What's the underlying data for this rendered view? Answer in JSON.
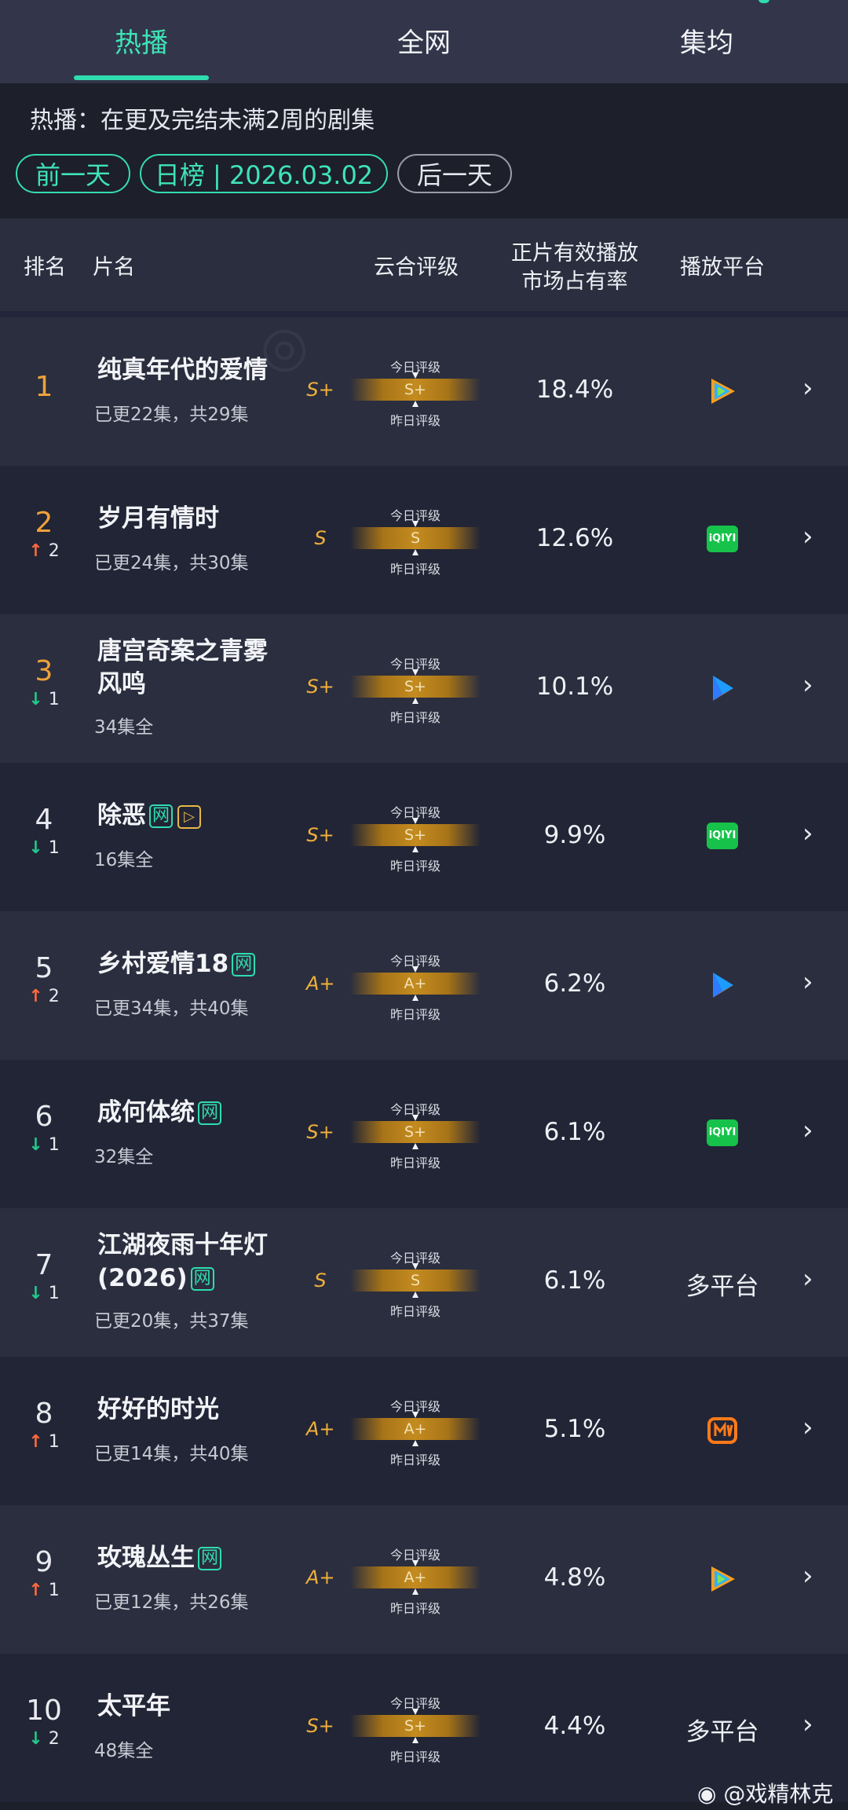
{
  "tabs": [
    {
      "label": "热播",
      "active": true
    },
    {
      "label": "全网",
      "active": false
    },
    {
      "label": "集均",
      "active": false
    }
  ],
  "description": "热播：在更及完结未满2周的剧集",
  "date_nav": {
    "prev": "前一天",
    "current": "日榜 | 2026.03.02",
    "next": "后一天"
  },
  "columns": {
    "rank": "排名",
    "title": "片名",
    "grade": "云合评级",
    "share_line1": "正片有效播放",
    "share_line2": "市场占有率",
    "platform": "播放平台"
  },
  "grade_labels": {
    "today": "今日评级",
    "yesterday": "昨日评级"
  },
  "rows": [
    {
      "rank": "1",
      "change": "",
      "dir": "",
      "title": "纯真年代的爱情",
      "title2": "",
      "badges": [],
      "episodes": "已更22集，共29集",
      "yesterday": "S+",
      "today": "S+",
      "share": "18.4%",
      "platform": "tencent-video-icon",
      "platform_text": ""
    },
    {
      "rank": "2",
      "change": "2",
      "dir": "up",
      "title": "岁月有情时",
      "title2": "",
      "badges": [],
      "episodes": "已更24集，共30集",
      "yesterday": "S",
      "today": "S",
      "share": "12.6%",
      "platform": "iqiyi-icon",
      "platform_text": "iQIYI"
    },
    {
      "rank": "3",
      "change": "1",
      "dir": "down",
      "title": "唐宫奇案之青雾",
      "title2": "风鸣",
      "badges": [],
      "episodes": "34集全",
      "yesterday": "S+",
      "today": "S+",
      "share": "10.1%",
      "platform": "youku-icon",
      "platform_text": ""
    },
    {
      "rank": "4",
      "change": "1",
      "dir": "down",
      "title": "除恶",
      "title2": "",
      "badges": [
        "网",
        "▷"
      ],
      "episodes": "16集全",
      "yesterday": "S+",
      "today": "S+",
      "share": "9.9%",
      "platform": "iqiyi-icon",
      "platform_text": "iQIYI"
    },
    {
      "rank": "5",
      "change": "2",
      "dir": "up",
      "title": "乡村爱情18",
      "title2": "",
      "badges": [
        "网"
      ],
      "episodes": "已更34集，共40集",
      "yesterday": "A+",
      "today": "A+",
      "share": "6.2%",
      "platform": "youku-icon",
      "platform_text": ""
    },
    {
      "rank": "6",
      "change": "1",
      "dir": "down",
      "title": "成何体统",
      "title2": "",
      "badges": [
        "网"
      ],
      "episodes": "32集全",
      "yesterday": "S+",
      "today": "S+",
      "share": "6.1%",
      "platform": "iqiyi-icon",
      "platform_text": "iQIYI"
    },
    {
      "rank": "7",
      "change": "1",
      "dir": "down",
      "title": "江湖夜雨十年灯",
      "title2": "(2026)",
      "badges": [
        "网"
      ],
      "episodes": "已更20集，共37集",
      "yesterday": "S",
      "today": "S",
      "share": "6.1%",
      "platform": "",
      "platform_text": "多平台"
    },
    {
      "rank": "8",
      "change": "1",
      "dir": "up",
      "title": "好好的时光",
      "title2": "",
      "badges": [],
      "episodes": "已更14集，共40集",
      "yesterday": "A+",
      "today": "A+",
      "share": "5.1%",
      "platform": "mango-tv-icon",
      "platform_text": ""
    },
    {
      "rank": "9",
      "change": "1",
      "dir": "up",
      "title": "玫瑰丛生",
      "title2": "",
      "badges": [
        "网"
      ],
      "episodes": "已更12集，共26集",
      "yesterday": "A+",
      "today": "A+",
      "share": "4.8%",
      "platform": "tencent-video-icon",
      "platform_text": ""
    },
    {
      "rank": "10",
      "change": "2",
      "dir": "down",
      "title": "太平年",
      "title2": "",
      "badges": [],
      "episodes": "48集全",
      "yesterday": "S+",
      "today": "S+",
      "share": "4.4%",
      "platform": "",
      "platform_text": "多平台"
    }
  ],
  "footer": "@戏精林克",
  "colors": {
    "accent": "#2fdcb0",
    "rank_top": "#f0a13a",
    "up": "#ff6a3d",
    "down": "#22c98d",
    "grade": "#f0b03a"
  }
}
